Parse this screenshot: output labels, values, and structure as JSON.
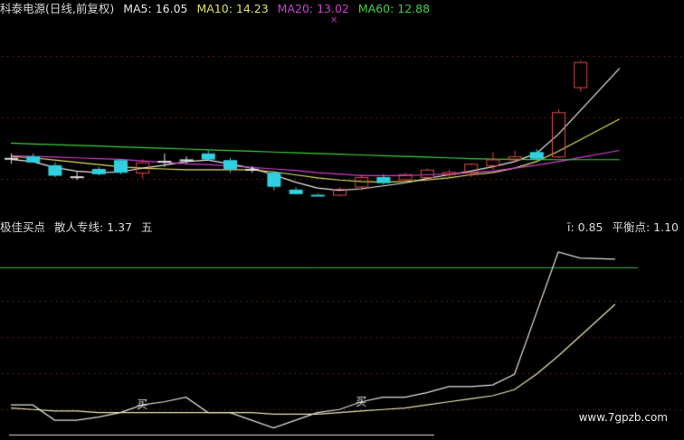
{
  "header": {
    "title": "科泰电源(日线,前复权)",
    "ma5_label": "MA5: 16.05",
    "ma10_label": "MA10: 14.23",
    "ma20_label": "MA20: 13.02",
    "ma60_label": "MA60: 12.88"
  },
  "indicator": {
    "left_a": "极佳买点",
    "left_b": "散人专线: 1.37",
    "left_c": "五",
    "right_a": "ī: 0.85",
    "right_b": "平衡点: 1.10"
  },
  "watermark": "www.7gpzb.com",
  "colors": {
    "background": "#000000",
    "up": "#e04848",
    "down": "#30d0e0",
    "flat": "#e0e0e0",
    "ma5": "#e8e8e8",
    "ma10": "#e0e060",
    "ma20": "#d040d0",
    "ma60": "#40d040",
    "grid_dots": "#b03030"
  },
  "chart_data": [
    {
      "type": "candlestick",
      "title": "科泰电源(日线,前复权)",
      "ylim": [
        9,
        22
      ],
      "candles": [
        {
          "o": 13.0,
          "h": 13.3,
          "l": 12.6,
          "c": 13.0
        },
        {
          "o": 13.1,
          "h": 13.3,
          "l": 12.7,
          "c": 12.75
        },
        {
          "o": 12.5,
          "h": 12.7,
          "l": 11.7,
          "c": 11.85
        },
        {
          "o": 11.75,
          "h": 12.1,
          "l": 11.5,
          "c": 11.75
        },
        {
          "o": 12.25,
          "h": 12.4,
          "l": 11.8,
          "c": 11.95
        },
        {
          "o": 12.85,
          "h": 12.9,
          "l": 11.9,
          "c": 12.05
        },
        {
          "o": 12.0,
          "h": 12.9,
          "l": 11.6,
          "c": 12.7
        },
        {
          "o": 12.8,
          "h": 13.3,
          "l": 12.4,
          "c": 12.8
        },
        {
          "o": 12.9,
          "h": 13.1,
          "l": 12.6,
          "c": 12.9
        },
        {
          "o": 13.3,
          "h": 13.5,
          "l": 12.8,
          "c": 12.95
        },
        {
          "o": 12.85,
          "h": 13.0,
          "l": 12.0,
          "c": 12.3
        },
        {
          "o": 12.25,
          "h": 12.45,
          "l": 12.0,
          "c": 12.25
        },
        {
          "o": 12.0,
          "h": 12.1,
          "l": 10.8,
          "c": 11.1
        },
        {
          "o": 10.85,
          "h": 11.0,
          "l": 10.55,
          "c": 10.6
        },
        {
          "o": 10.5,
          "h": 10.6,
          "l": 10.4,
          "c": 10.45
        },
        {
          "o": 10.5,
          "h": 11.0,
          "l": 10.4,
          "c": 10.9
        },
        {
          "o": 11.05,
          "h": 11.9,
          "l": 10.8,
          "c": 11.7
        },
        {
          "o": 11.7,
          "h": 11.9,
          "l": 11.2,
          "c": 11.35
        },
        {
          "o": 11.55,
          "h": 12.0,
          "l": 11.3,
          "c": 11.9
        },
        {
          "o": 11.7,
          "h": 12.3,
          "l": 11.5,
          "c": 12.2
        },
        {
          "o": 11.9,
          "h": 12.2,
          "l": 11.7,
          "c": 12.05
        },
        {
          "o": 12.0,
          "h": 12.5,
          "l": 11.7,
          "c": 12.6
        },
        {
          "o": 12.5,
          "h": 13.4,
          "l": 12.2,
          "c": 12.9
        },
        {
          "o": 12.9,
          "h": 13.5,
          "l": 12.7,
          "c": 13.1
        },
        {
          "o": 13.4,
          "h": 13.6,
          "l": 12.9,
          "c": 13.0
        },
        {
          "o": 13.1,
          "h": 16.3,
          "l": 13.0,
          "c": 16.1
        },
        {
          "o": 17.8,
          "h": 19.6,
          "l": 17.5,
          "c": 19.5
        }
      ],
      "series": [
        {
          "name": "MA5",
          "values": [
            12.9,
            12.75,
            12.35,
            12.1,
            12.0,
            12.05,
            12.3,
            12.5,
            12.75,
            12.85,
            12.6,
            12.3,
            11.85,
            11.35,
            10.95,
            10.8,
            10.9,
            11.1,
            11.3,
            11.6,
            11.85,
            12.1,
            12.4,
            12.75,
            13.3,
            14.6,
            16.2
          ]
        },
        {
          "name": "MA10",
          "values": [
            13.1,
            13.0,
            12.85,
            12.7,
            12.55,
            12.4,
            12.3,
            12.25,
            12.2,
            12.2,
            12.2,
            12.2,
            12.05,
            11.85,
            11.65,
            11.5,
            11.4,
            11.35,
            11.4,
            11.5,
            11.65,
            11.85,
            12.0,
            12.3,
            12.75,
            13.45,
            14.23
          ]
        },
        {
          "name": "MA20",
          "values": [
            13.15,
            13.1,
            13.05,
            13.0,
            12.95,
            12.9,
            12.8,
            12.7,
            12.6,
            12.55,
            12.45,
            12.35,
            12.25,
            12.15,
            12.0,
            11.9,
            11.8,
            11.8,
            11.8,
            11.85,
            11.9,
            12.0,
            12.1,
            12.3,
            12.5,
            12.75,
            13.02
          ]
        },
        {
          "name": "MA60",
          "values": [
            14.0,
            13.95,
            13.9,
            13.85,
            13.8,
            13.75,
            13.7,
            13.65,
            13.6,
            13.55,
            13.5,
            13.45,
            13.4,
            13.35,
            13.3,
            13.25,
            13.2,
            13.15,
            13.1,
            13.05,
            13.0,
            12.95,
            12.92,
            12.9,
            12.89,
            12.88,
            12.88
          ]
        }
      ]
    },
    {
      "type": "line",
      "title": "极佳买点",
      "ylim": [
        -0.1,
        1.2
      ],
      "reference_line": 1.0,
      "markers": [
        {
          "label": "买",
          "x": 6
        },
        {
          "label": "买",
          "x": 16
        }
      ],
      "series": [
        {
          "name": "散人专线",
          "values": [
            0.1,
            0.1,
            0.0,
            0.0,
            0.02,
            0.05,
            0.1,
            0.12,
            0.15,
            0.05,
            0.05,
            0.0,
            -0.05,
            0.0,
            0.05,
            0.07,
            0.12,
            0.15,
            0.15,
            0.18,
            0.22,
            0.22,
            0.23,
            0.3,
            0.7,
            1.1,
            1.06
          ]
        },
        {
          "name": "平衡点",
          "values": [
            0.08,
            0.07,
            0.06,
            0.06,
            0.05,
            0.05,
            0.05,
            0.05,
            0.05,
            0.05,
            0.05,
            0.05,
            0.04,
            0.04,
            0.04,
            0.05,
            0.06,
            0.07,
            0.08,
            0.1,
            0.12,
            0.14,
            0.16,
            0.2,
            0.3,
            0.42,
            0.55
          ]
        }
      ]
    }
  ]
}
